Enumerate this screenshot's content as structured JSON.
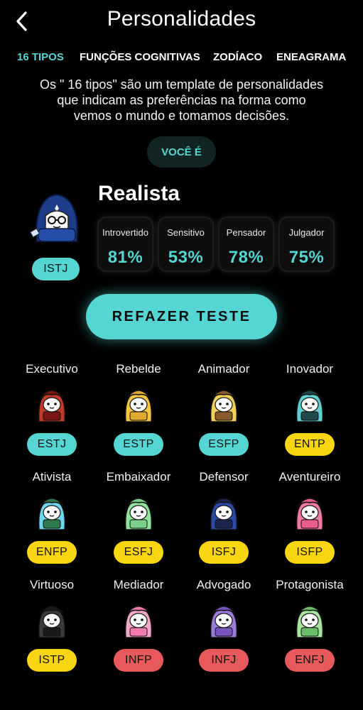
{
  "header": {
    "title": "Personalidades",
    "back_icon": "chevron-left-icon"
  },
  "tabs": [
    {
      "label": "16 TIPOS",
      "active": true
    },
    {
      "label": "FUNÇÕES COGNITIVAS",
      "active": false
    },
    {
      "label": "ZODÍACO",
      "active": false
    },
    {
      "label": "ENEAGRAMA",
      "active": false
    }
  ],
  "intro": {
    "line1": "Os \" 16 tipos\" são um template de personalidades",
    "line2": "que indicam as preferências na forma como",
    "line3": "vemos o mundo e tomamos decisões."
  },
  "result": {
    "you_are_label": "VOCÊ É",
    "type_code": "ISTJ",
    "type_name": "Realista",
    "avatar": "wizard-avatar-navy",
    "traits": [
      {
        "label": "Introvertido",
        "value": "81%"
      },
      {
        "label": "Sensitivo",
        "value": "53%"
      },
      {
        "label": "Pensador",
        "value": "78%"
      },
      {
        "label": "Julgador",
        "value": "75%"
      }
    ]
  },
  "retake_button": "REFAZER TESTE",
  "colors": {
    "accent_cyan": "#55d6d2",
    "accent_yellow": "#f8d511",
    "accent_red": "#e8595b",
    "background": "#000000"
  },
  "types": [
    {
      "name": "Executivo",
      "code": "ESTJ",
      "badge_color": "cyan",
      "avatar_color": "#c0392b",
      "hair_color": "#7a1515"
    },
    {
      "name": "Rebelde",
      "code": "ESTP",
      "badge_color": "cyan",
      "avatar_color": "#f5c542",
      "hair_color": "#e0a82e"
    },
    {
      "name": "Animador",
      "code": "ESFP",
      "badge_color": "cyan",
      "avatar_color": "#f2cf5b",
      "hair_color": "#8b5a2b"
    },
    {
      "name": "Inovador",
      "code": "ENTP",
      "badge_color": "yellow",
      "avatar_color": "#5fd0cf",
      "hair_color": "#1f4a4a"
    },
    {
      "name": "Ativista",
      "code": "ENFP",
      "badge_color": "yellow",
      "avatar_color": "#6fd6f0",
      "hair_color": "#2f7a4a"
    },
    {
      "name": "Embaixador",
      "code": "ESFJ",
      "badge_color": "yellow",
      "avatar_color": "#8fe39a",
      "hair_color": "#7ad08a"
    },
    {
      "name": "Defensor",
      "code": "ISFJ",
      "badge_color": "yellow",
      "avatar_color": "#2a4aa8",
      "hair_color": "#1b2550"
    },
    {
      "name": "Aventureiro",
      "code": "ISFP",
      "badge_color": "yellow",
      "avatar_color": "#f07aa0",
      "hair_color": "#e85d8a"
    },
    {
      "name": "Virtuoso",
      "code": "ISTP",
      "badge_color": "yellow",
      "avatar_color": "#3a3a3a",
      "hair_color": "#1a1a1a"
    },
    {
      "name": "Mediador",
      "code": "INFP",
      "badge_color": "red",
      "avatar_color": "#f3a7c6",
      "hair_color": "#f27ab0"
    },
    {
      "name": "Advogado",
      "code": "INFJ",
      "badge_color": "red",
      "avatar_color": "#9b7ad8",
      "hair_color": "#7a55c0"
    },
    {
      "name": "Protagonista",
      "code": "ENFJ",
      "badge_color": "red",
      "avatar_color": "#a8e6a0",
      "hair_color": "#6cbf6a"
    }
  ]
}
